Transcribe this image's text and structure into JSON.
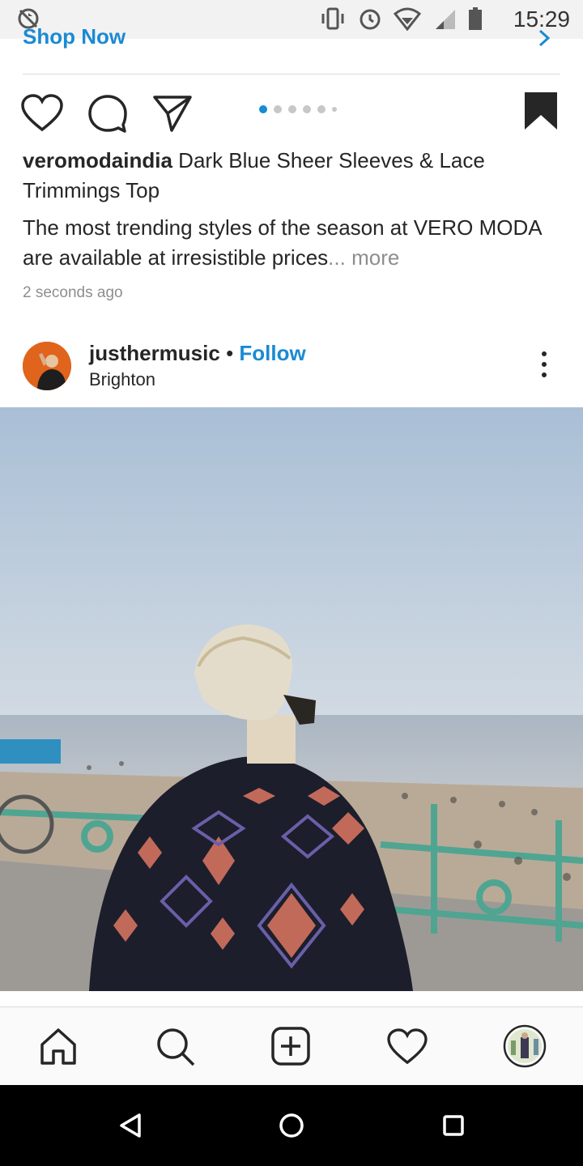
{
  "status_bar": {
    "time": "15:29",
    "icons": [
      "sync-disabled-icon",
      "vibrate-icon",
      "alarm-icon",
      "wifi-icon",
      "signal-icon",
      "battery-icon"
    ]
  },
  "ad": {
    "cta_label": "Shop Now"
  },
  "post1": {
    "username": "veromodaindia",
    "title": "Dark Blue Sheer Sleeves & Lace Trimmings Top",
    "description": "The most trending styles of the season at VERO MODA are available at irresistible prices",
    "ellipsis": "...",
    "more_label": "more",
    "timestamp": "2 seconds ago",
    "carousel": {
      "count": 6,
      "active_index": 0
    }
  },
  "post2": {
    "username": "justhermusic",
    "separator": "•",
    "follow_label": "Follow",
    "location": "Brighton"
  },
  "bottom_nav": {
    "items": [
      "home-icon",
      "search-icon",
      "add-post-icon",
      "activity-heart-icon",
      "profile-avatar"
    ]
  },
  "system_nav": {
    "items": [
      "back-icon",
      "home-circle-icon",
      "recents-icon"
    ]
  },
  "colors": {
    "accent": "#1a8ad4",
    "text": "#262626",
    "muted": "#8e8e8e"
  }
}
